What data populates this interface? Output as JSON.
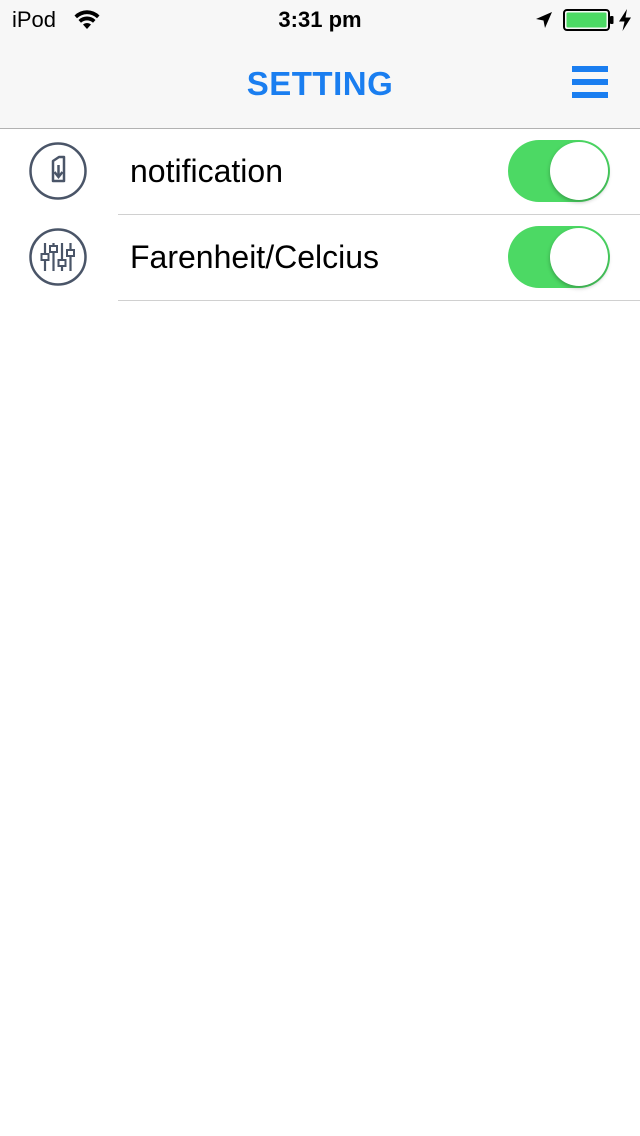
{
  "status_bar": {
    "carrier": "iPod",
    "time": "3:31 pm",
    "icons": [
      "wifi-icon",
      "location-arrow-icon",
      "battery-icon",
      "charging-bolt-icon"
    ]
  },
  "nav": {
    "title": "SETTING",
    "menu_icon": "hamburger-menu-icon"
  },
  "settings": {
    "items": [
      {
        "label": "notification",
        "icon": "phone-notification-icon",
        "enabled": true
      },
      {
        "label": "Farenheit/Celcius",
        "icon": "equalizer-sliders-icon",
        "enabled": true
      }
    ]
  },
  "colors": {
    "accent": "#1a7ef0",
    "toggle_on": "#4cd964",
    "battery": "#4cd964",
    "icon_stroke": "#4a5568"
  }
}
